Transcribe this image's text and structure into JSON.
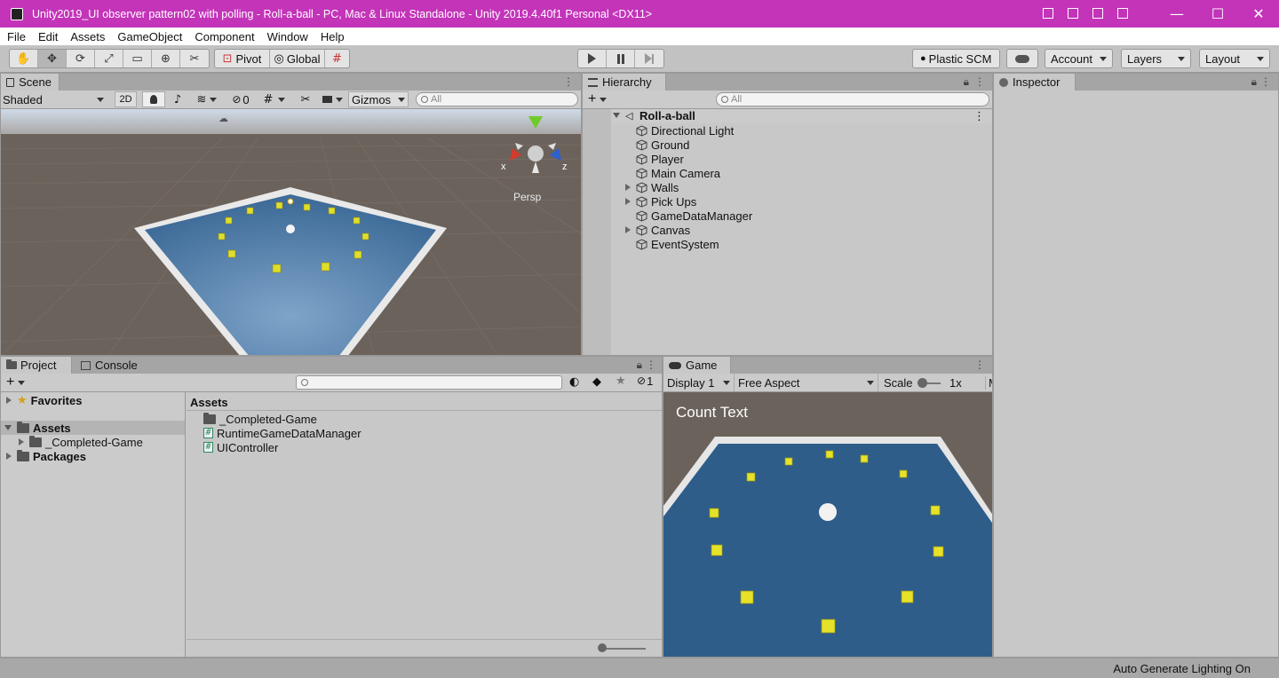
{
  "window": {
    "title": "Unity2019_UI observer pattern02 with polling - Roll-a-ball - PC, Mac & Linux Standalone - Unity 2019.4.40f1 Personal <DX11>",
    "controls": {
      "minimize": "—",
      "maximize": "☐",
      "close": "✕"
    }
  },
  "menu": [
    "File",
    "Edit",
    "Assets",
    "GameObject",
    "Component",
    "Window",
    "Help"
  ],
  "toolbar": {
    "tools": [
      "hand-tool",
      "move-tool",
      "rotate-tool",
      "scale-tool",
      "rect-tool",
      "transform-tool",
      "custom-tool"
    ],
    "pivot": "Pivot",
    "global": "Global",
    "play_icons": [
      "play-icon",
      "pause-icon",
      "step-icon"
    ],
    "plastic": "Plastic SCM",
    "account": "Account",
    "layers": "Layers",
    "layout": "Layout"
  },
  "scene": {
    "tab": "Scene",
    "shading": "Shaded",
    "mode2d": "2D",
    "hidden_count": "0",
    "gizmos": "Gizmos",
    "search_placeholder": "All",
    "persp": "Persp",
    "axis_x": "x",
    "axis_z": "z"
  },
  "hierarchy": {
    "tab": "Hierarchy",
    "search_placeholder": "All",
    "root": "Roll-a-ball",
    "items": [
      {
        "label": "Directional Light",
        "has_children": false
      },
      {
        "label": "Ground",
        "has_children": false
      },
      {
        "label": "Player",
        "has_children": false
      },
      {
        "label": "Main Camera",
        "has_children": false
      },
      {
        "label": "Walls",
        "has_children": true
      },
      {
        "label": "Pick Ups",
        "has_children": true
      },
      {
        "label": "GameDataManager",
        "has_children": false
      },
      {
        "label": "Canvas",
        "has_children": true
      },
      {
        "label": "EventSystem",
        "has_children": false
      }
    ]
  },
  "inspector": {
    "tab": "Inspector"
  },
  "project": {
    "tab": "Project",
    "console_tab": "Console",
    "hidden_count": "1",
    "tree": {
      "favorites": "Favorites",
      "assets": "Assets",
      "assets_child": "_Completed-Game",
      "packages": "Packages"
    },
    "content_header": "Assets",
    "files": [
      {
        "name": "_Completed-Game",
        "type": "folder"
      },
      {
        "name": "RuntimeGameDataManager",
        "type": "script"
      },
      {
        "name": "UIController",
        "type": "script"
      }
    ]
  },
  "game": {
    "tab": "Game",
    "display": "Display 1",
    "aspect": "Free Aspect",
    "scale_label": "Scale",
    "scale_value": "1x",
    "clipped_label": "M",
    "count_text": "Count Text"
  },
  "status": {
    "lighting": "Auto Generate Lighting On"
  },
  "colors": {
    "titlebar": "#c334b9",
    "floor": "#2f5d8a",
    "pickup": "#e6e22a",
    "ground": "#6b625b"
  }
}
